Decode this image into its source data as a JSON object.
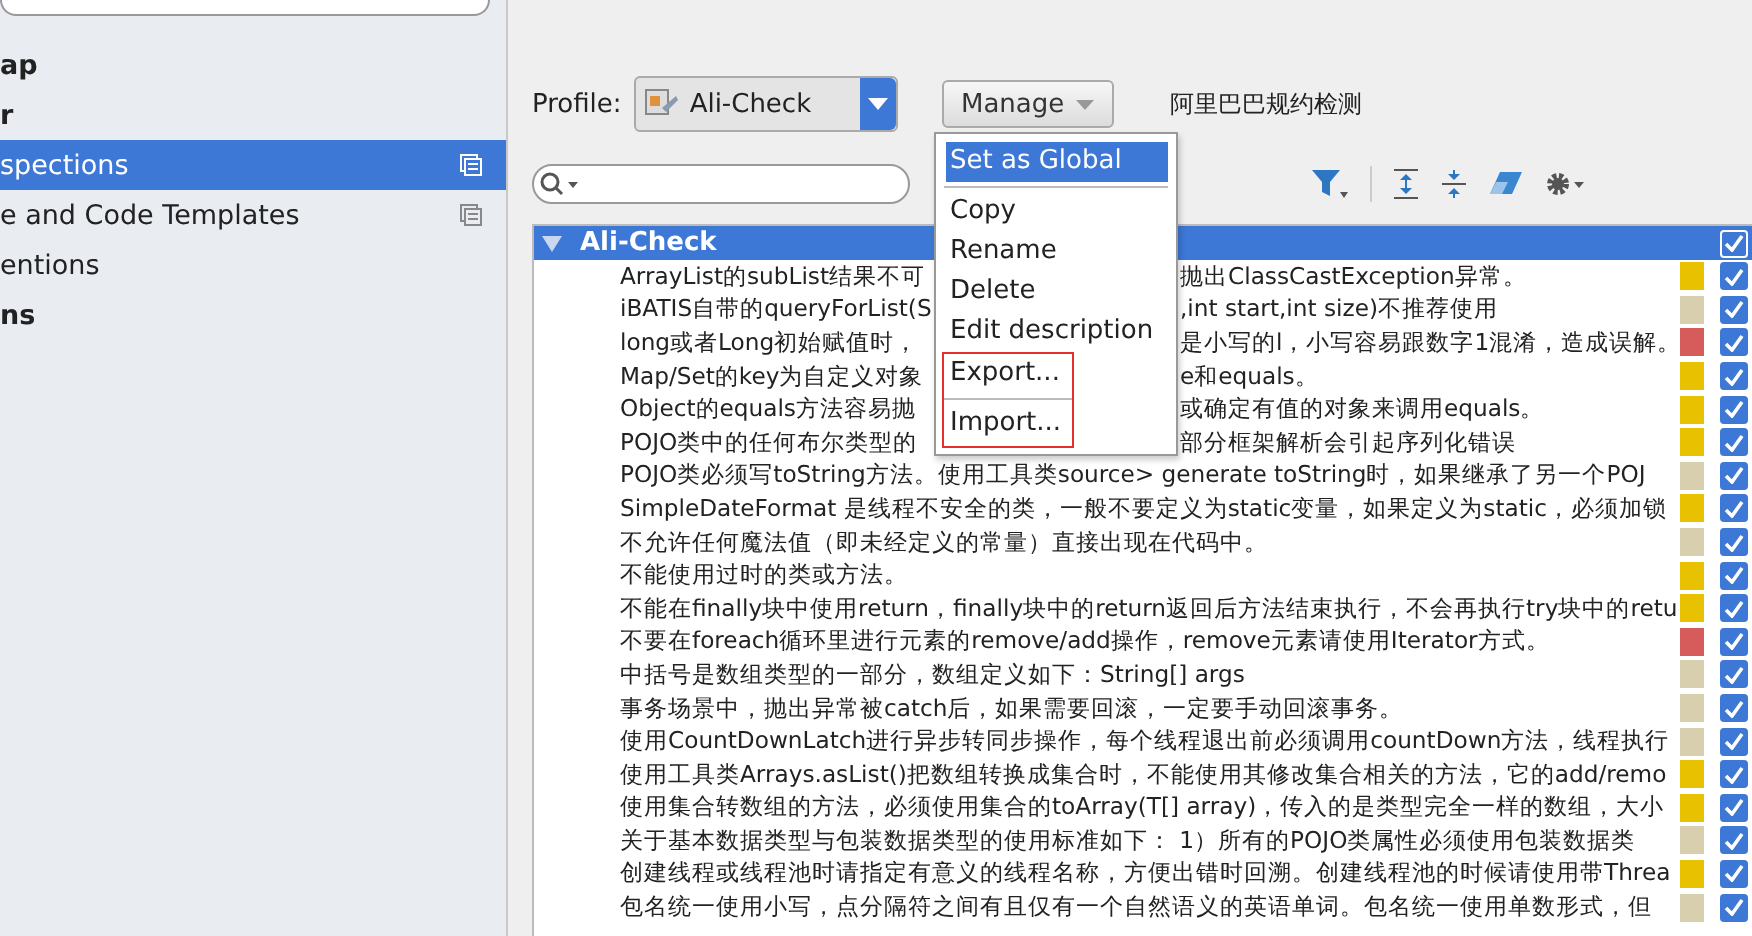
{
  "sidebar": {
    "items": [
      {
        "label": "ap",
        "bold": true,
        "selected": false,
        "copy_icon": false
      },
      {
        "label": "r",
        "bold": true,
        "selected": false,
        "copy_icon": false
      },
      {
        "label": "spections",
        "bold": false,
        "selected": true,
        "copy_icon": true
      },
      {
        "label": "e and Code Templates",
        "bold": false,
        "selected": false,
        "copy_icon": true
      },
      {
        "label": "entions",
        "bold": false,
        "selected": false,
        "copy_icon": false
      },
      {
        "label": "ns",
        "bold": true,
        "selected": false,
        "copy_icon": false
      }
    ]
  },
  "profile": {
    "label": "Profile:",
    "value": "Ali-Check",
    "manage": "Manage",
    "description": "阿里巴巴规约检测"
  },
  "menu": {
    "items": [
      {
        "label": "Set as Global",
        "selected": true,
        "separator_after": true
      },
      {
        "label": "Copy",
        "selected": false,
        "separator_after": false
      },
      {
        "label": "Rename",
        "selected": false,
        "separator_after": false
      },
      {
        "label": "Delete",
        "selected": false,
        "separator_after": false
      },
      {
        "label": "Edit description",
        "selected": false,
        "separator_after": false
      },
      {
        "label": "Export...",
        "selected": false,
        "separator_after": true,
        "highlighted": true
      },
      {
        "label": "Import...",
        "selected": false,
        "separator_after": false,
        "highlighted": true
      }
    ]
  },
  "tree": {
    "root": {
      "label": "Ali-Check",
      "expanded": true,
      "checked": true
    },
    "rows": [
      {
        "text": "ArrayList的subList结果不可",
        "tail": "抛出ClassCastException异常。",
        "color": "#e8c200",
        "checked": true
      },
      {
        "text": "iBATIS自带的queryForList(S",
        "tail": ",int start,int size)不推荐使用",
        "color": "#d8cfae",
        "checked": true
      },
      {
        "text": "long或者Long初始赋值时，",
        "tail": "是小写的l，小写容易跟数字1混淆，造成误解。",
        "color": "#d65c5c",
        "checked": true
      },
      {
        "text": "Map/Set的key为自定义对象",
        "tail": "e和equals。",
        "color": "#e8c200",
        "checked": true
      },
      {
        "text": "Object的equals方法容易抛",
        "tail": "或确定有值的对象来调用equals。",
        "color": "#e8c200",
        "checked": true
      },
      {
        "text": "POJO类中的任何布尔类型的",
        "tail": "部分框架解析会引起序列化错误",
        "color": "#e8c200",
        "checked": true
      },
      {
        "text": "POJO类必须写toString方法。使用工具类source> generate toString时，如果继承了另一个POJ",
        "color": "#d8cfae",
        "checked": true
      },
      {
        "text": "SimpleDateFormat 是线程不安全的类，一般不要定义为static变量，如果定义为static，必须加锁",
        "color": "#e8c200",
        "checked": true
      },
      {
        "text": "不允许任何魔法值（即未经定义的常量）直接出现在代码中。",
        "color": "#d8cfae",
        "checked": true
      },
      {
        "text": "不能使用过时的类或方法。",
        "color": "#e8c200",
        "checked": true
      },
      {
        "text": "不能在finally块中使用return，finally块中的return返回后方法结束执行，不会再执行try块中的retu",
        "color": "#e8c200",
        "checked": true
      },
      {
        "text": "不要在foreach循环里进行元素的remove/add操作，remove元素请使用Iterator方式。",
        "color": "#d65c5c",
        "checked": true
      },
      {
        "text": "中括号是数组类型的一部分，数组定义如下：String[] args",
        "color": "#d8cfae",
        "checked": true
      },
      {
        "text": "事务场景中，抛出异常被catch后，如果需要回滚，一定要手动回滚事务。",
        "color": "#d8cfae",
        "checked": true
      },
      {
        "text": "使用CountDownLatch进行异步转同步操作，每个线程退出前必须调用countDown方法，线程执行",
        "color": "#d8cfae",
        "checked": true
      },
      {
        "text": "使用工具类Arrays.asList()把数组转换成集合时，不能使用其修改集合相关的方法，它的add/remo",
        "color": "#e8c200",
        "checked": true
      },
      {
        "text": "使用集合转数组的方法，必须使用集合的toArray(T[] array)，传入的是类型完全一样的数组，大小",
        "color": "#e8c200",
        "checked": true
      },
      {
        "text": "关于基本数据类型与包装数据类型的使用标准如下：   1）所有的POJO类属性必须使用包装数据类",
        "color": "#d8cfae",
        "checked": true
      },
      {
        "text": "创建线程或线程池时请指定有意义的线程名称，方便出错时回溯。创建线程池的时候请使用带Threa",
        "color": "#e8c200",
        "checked": true
      },
      {
        "text": "包名统一使用小写，点分隔符之间有且仅有一个自然语义的英语单词。包名统一使用单数形式，但",
        "color": "#d8cfae",
        "checked": true
      }
    ]
  }
}
